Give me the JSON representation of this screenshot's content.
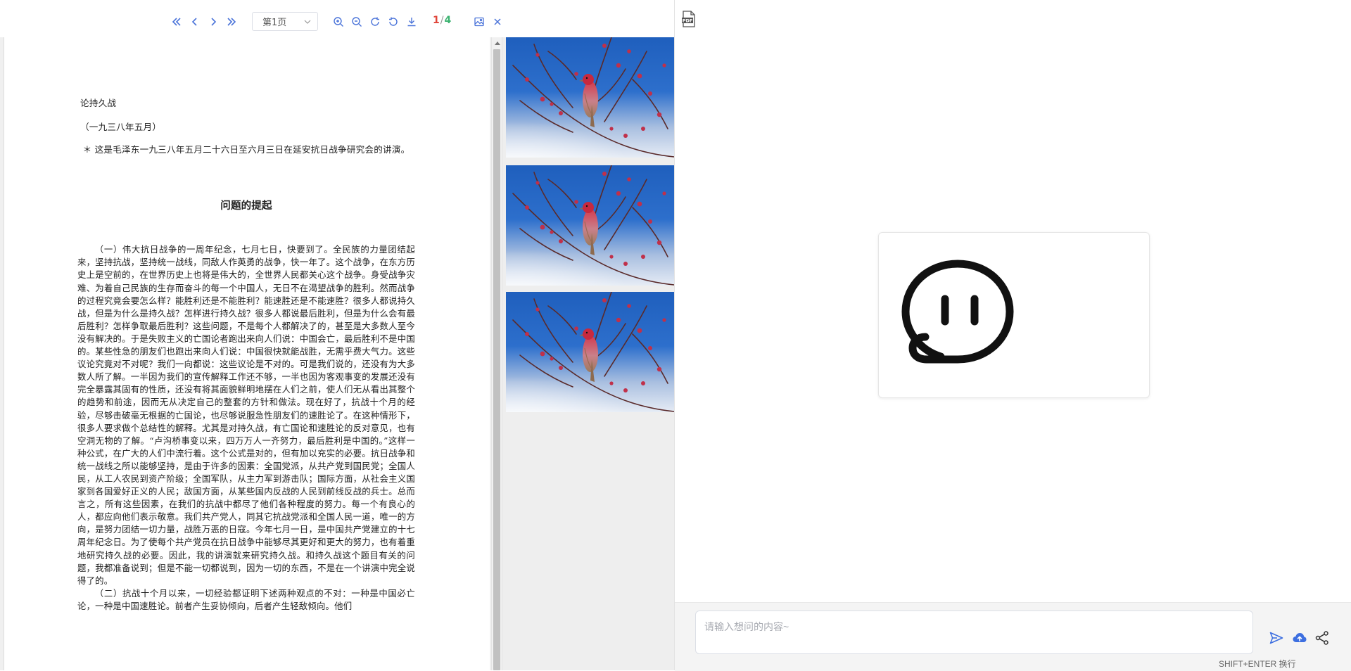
{
  "toolbar": {
    "page_select": "第1页",
    "current_page": "1",
    "separator": "/",
    "total_pages": "4",
    "icons": [
      "first-page-icon",
      "prev-page-icon",
      "next-page-icon",
      "last-page-icon",
      "zoom-in-icon",
      "zoom-out-icon",
      "rotate-cw-icon",
      "rotate-ccw-icon",
      "download-icon",
      "thumbnail-toggle-icon",
      "close-icon"
    ]
  },
  "document": {
    "title": "论持久战",
    "date": "（一九三八年五月）",
    "note": "＊ 这是毛泽东一九三八年五月二十六日至六月三日在延安抗日战争研究会的讲演。",
    "heading": "问题的提起",
    "paragraphs": [
      "（一）伟大抗日战争的一周年纪念，七月七日，快要到了。全民族的力量团结起来，坚持抗战，坚持统一战线，同敌人作英勇的战争，快一年了。这个战争，在东方历史上是空前的，在世界历史上也将是伟大的，全世界人民都关心这个战争。身受战争灾难、为着自己民族的生存而奋斗的每一个中国人，无日不在渴望战争的胜利。然而战争的过程究竟会要怎么样？能胜利还是不能胜利？能速胜还是不能速胜？很多人都说持久战，但是为什么是持久战？怎样进行持久战？很多人都说最后胜利，但是为什么会有最后胜利？怎样争取最后胜利？这些问题，不是每个人都解决了的，甚至是大多数人至今没有解决的。于是失败主义的亡国论者跑出来向人们说：中国会亡，最后胜利不是中国的。某些性急的朋友们也跑出来向人们说：中国很快就能战胜，无需乎费大气力。这些议论究竟对不对呢？我们一向都说：这些议论是不对的。可是我们说的，还没有为大多数人所了解。一半因为我们的宣传解释工作还不够，一半也因为客观事变的发展还没有完全暴露其固有的性质，还没有将其面貌鲜明地摆在人们之前，使人们无从看出其整个的趋势和前途，因而无从决定自己的整套的方针和做法。现在好了，抗战十个月的经验，尽够击破毫无根据的亡国论，也尽够说服急性朋友们的速胜论了。在这种情形下，很多人要求做个总结性的解释。尤其是对持久战，有亡国论和速胜论的反对意见，也有空洞无物的了解。“卢沟桥事变以来，四万万人一齐努力，最后胜利是中国的。”这样一种公式，在广大的人们中流行着。这个公式是对的，但有加以充实的必要。抗日战争和统一战线之所以能够坚持，是由于许多的因素：全国党派，从共产党到国民党；全国人民，从工人农民到资产阶级；全国军队，从主力军到游击队；国际方面，从社会主义国家到各国爱好正义的人民；敌国方面，从某些国内反战的人民到前线反战的兵士。总而言之，所有这些因素，在我们的抗战中都尽了他们各种程度的努力。每一个有良心的人，都应向他们表示敬意。我们共产党人，同其它抗战党派和全国人民一道，唯一的方向，是努力团结一切力量，战胜万恶的日寇。今年七月一日，是中国共产党建立的十七周年纪念日。为了使每个共产党员在抗日战争中能够尽其更好和更大的努力，也有着重地研究持久战的必要。因此，我的讲演就来研究持久战。和持久战这个题目有关的问题，我都准备说到；但是不能一切都说到，因为一切的东西，不是在一个讲演中完全说得了的。",
      "（二）抗战十个月以来，一切经验都证明下述两种观点的不对：一种是中国必亡论，一种是中国速胜论。前者产生妥协倾向，后者产生轻敌倾向。他们"
    ]
  },
  "thumbnails": {
    "count": 3
  },
  "chat": {
    "pdf_icon_label": "PDF",
    "input_placeholder": "请输入想问的内容~",
    "input_value": "",
    "hint": "SHIFT+ENTER 换行",
    "actions": [
      "send-icon",
      "upload-cloud-icon",
      "share-icon"
    ]
  },
  "colors": {
    "accent": "#4a73d9",
    "current_page": "#e0453a",
    "total_pages": "#3cb371"
  }
}
